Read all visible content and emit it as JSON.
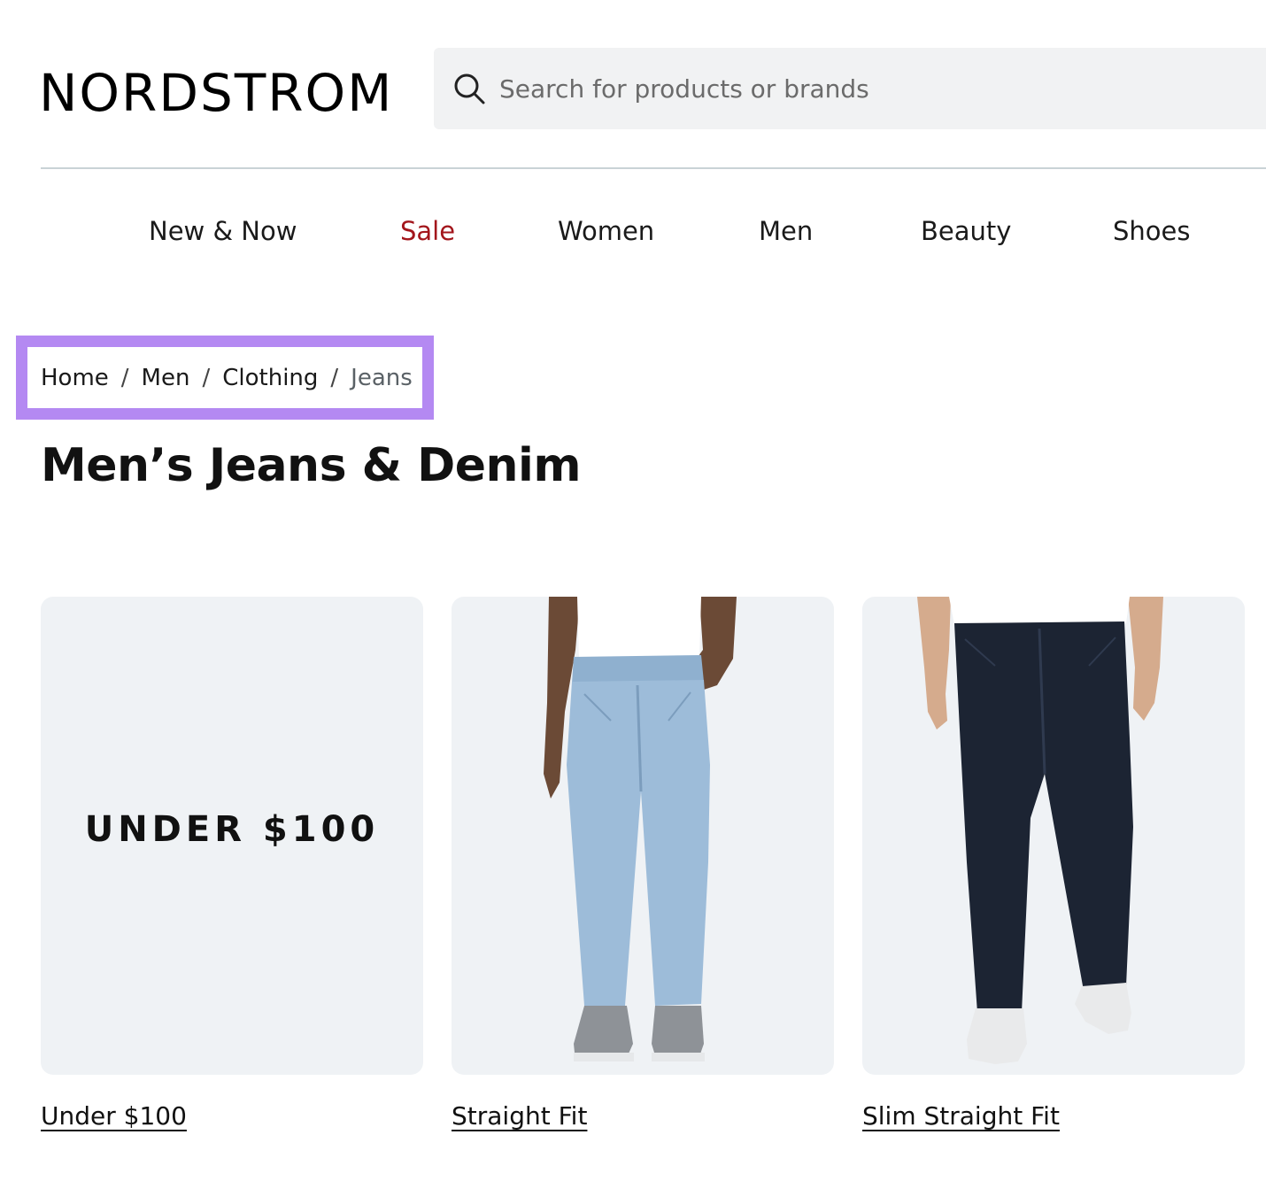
{
  "header": {
    "logo": "NORDSTROM",
    "search_placeholder": "Search for products or brands",
    "search_icon": "search-icon"
  },
  "nav": {
    "items": [
      {
        "label": "New & Now"
      },
      {
        "label": "Sale",
        "color": "#a3161c"
      },
      {
        "label": "Women"
      },
      {
        "label": "Men"
      },
      {
        "label": "Beauty"
      },
      {
        "label": "Shoes"
      }
    ]
  },
  "breadcrumb": {
    "items": [
      "Home",
      "Men",
      "Clothing",
      "Jeans"
    ],
    "separator": "/",
    "highlight_color": "#b489f2"
  },
  "page_title": "Men’s Jeans & Denim",
  "categories": [
    {
      "label": "Under $100",
      "promo_text": "UNDER $100"
    },
    {
      "label": "Straight Fit",
      "image": "light-wash-jeans-model"
    },
    {
      "label": "Slim Straight Fit",
      "image": "dark-wash-jeans-model"
    }
  ]
}
